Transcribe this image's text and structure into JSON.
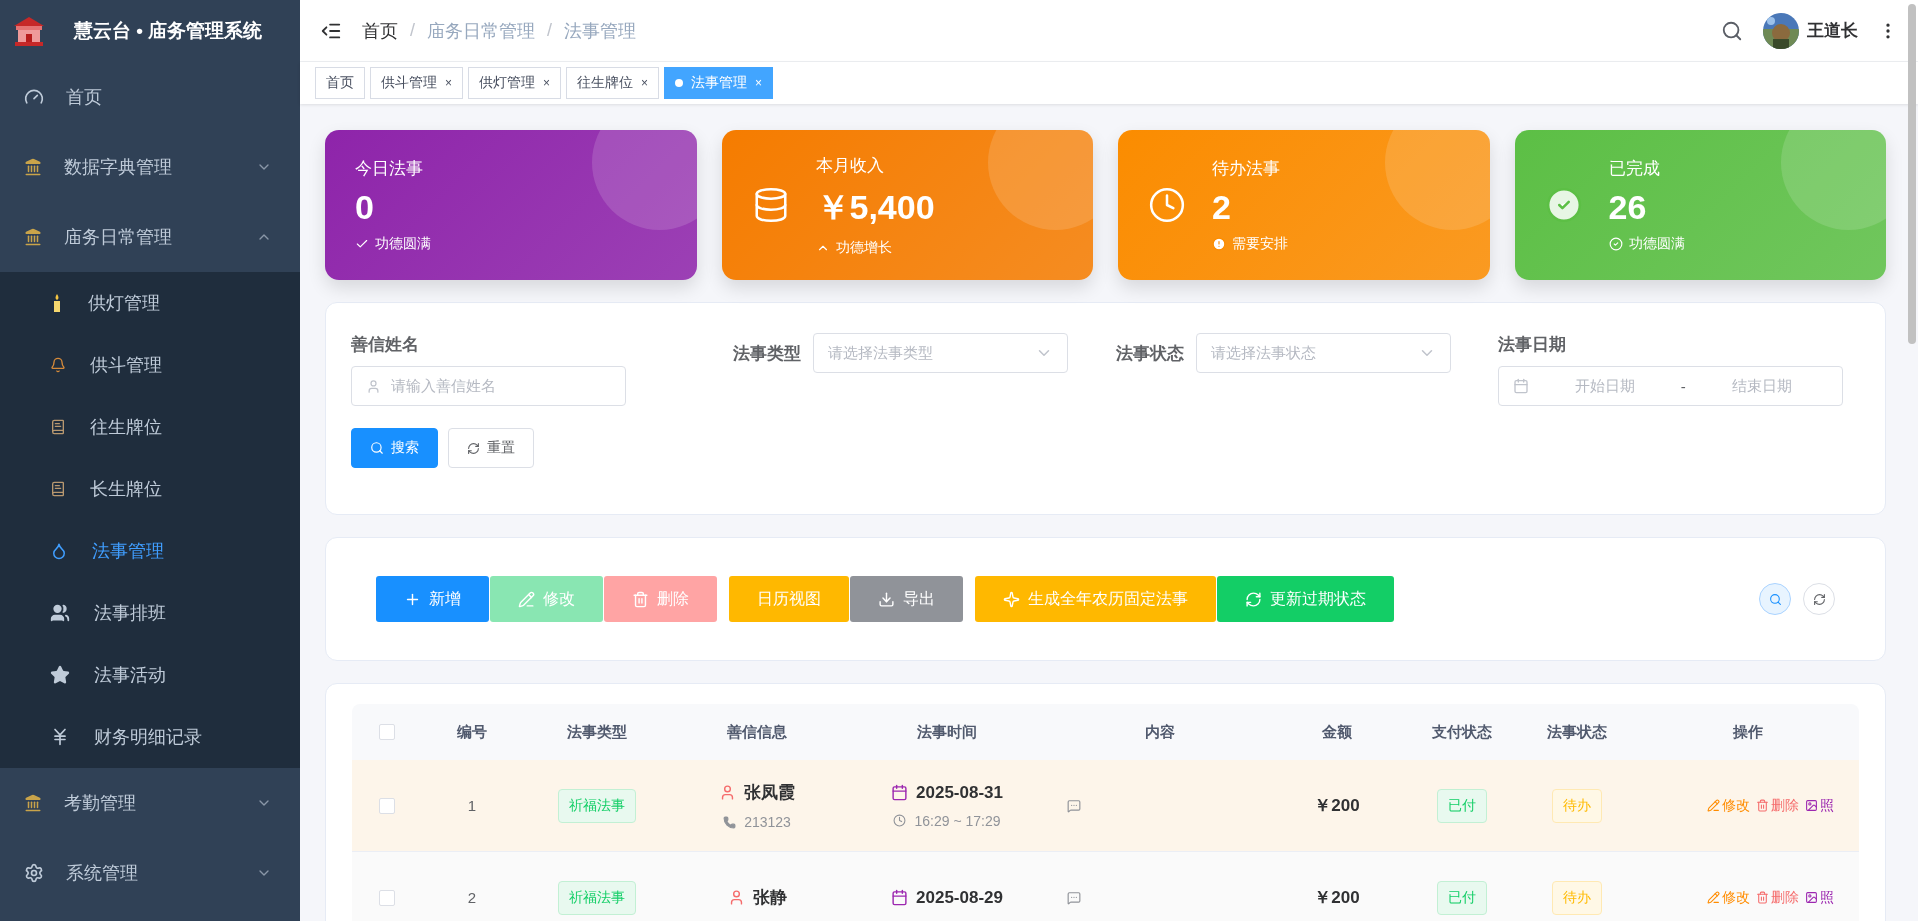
{
  "sidebar": {
    "title": "慧云台 • 庙务管理系统",
    "items": [
      {
        "label": "首页",
        "kind": "link",
        "selected": false
      },
      {
        "label": "数据字典管理",
        "kind": "group",
        "expanded": false
      },
      {
        "label": "庙务日常管理",
        "kind": "group",
        "expanded": true,
        "children": [
          {
            "label": "供灯管理",
            "selected": false
          },
          {
            "label": "供斗管理",
            "selected": false
          },
          {
            "label": "往生牌位",
            "selected": false
          },
          {
            "label": "长生牌位",
            "selected": false
          },
          {
            "label": "法事管理",
            "selected": true
          },
          {
            "label": "法事排班",
            "selected": false
          },
          {
            "label": "法事活动",
            "selected": false
          },
          {
            "label": "财务明细记录",
            "selected": false
          }
        ]
      },
      {
        "label": "考勤管理",
        "kind": "group",
        "expanded": false
      },
      {
        "label": "系统管理",
        "kind": "group",
        "expanded": false
      }
    ]
  },
  "header": {
    "breadcrumb": [
      "首页",
      "庙务日常管理",
      "法事管理"
    ],
    "separator": "/",
    "user": "王道长"
  },
  "tabs": [
    {
      "label": "首页",
      "closable": false,
      "selected": false
    },
    {
      "label": "供斗管理",
      "closable": true,
      "selected": false
    },
    {
      "label": "供灯管理",
      "closable": true,
      "selected": false
    },
    {
      "label": "往生牌位",
      "closable": true,
      "selected": false
    },
    {
      "label": "法事管理",
      "closable": true,
      "selected": true
    }
  ],
  "tab_close": "×",
  "stats": [
    {
      "title": "今日法事",
      "value": "0",
      "note": "功德圆满",
      "color": "#8e24aa"
    },
    {
      "title": "本月收入",
      "value": "￥5,400",
      "note": "功德增长",
      "color": "#f57c00"
    },
    {
      "title": "待办法事",
      "value": "2",
      "note": "需要安排",
      "color": "#fb8c00"
    },
    {
      "title": "已完成",
      "value": "26",
      "note": "功德圆满",
      "color": "#5cbf45"
    }
  ],
  "filters": [
    {
      "label": "善信姓名",
      "kind": "text",
      "placeholder": "请输入善信姓名"
    },
    {
      "label": "法事类型",
      "kind": "select",
      "placeholder": "请选择法事类型"
    },
    {
      "label": "法事状态",
      "kind": "select",
      "placeholder": "请选择法事状态"
    },
    {
      "label": "法事日期",
      "kind": "daterange",
      "start_placeholder": "开始日期",
      "separator": "-",
      "end_placeholder": "结束日期"
    }
  ],
  "filter_buttons": [
    {
      "label": "搜索",
      "kind": "primary"
    },
    {
      "label": "重置",
      "kind": "plain"
    }
  ],
  "toolbar": [
    [
      {
        "label": "新增",
        "color": "#1890ff"
      },
      {
        "label": "修改",
        "color": "#89e6b2"
      },
      {
        "label": "删除",
        "color": "#ffa4a4"
      }
    ],
    [
      {
        "label": "日历视图",
        "color": "#ffb800"
      },
      {
        "label": "导出",
        "color": "#909399"
      }
    ],
    [
      {
        "label": "生成全年农历固定法事",
        "color": "#ffb800"
      },
      {
        "label": "更新过期状态",
        "color": "#13ce66"
      }
    ]
  ],
  "table": {
    "all_checked": false,
    "columns": [
      "编号",
      "法事类型",
      "善信信息",
      "法事时间",
      "内容",
      "金额",
      "支付状态",
      "法事状态",
      "操作"
    ],
    "rows": [
      {
        "checked": false,
        "highlighted": true,
        "number": "1",
        "type": "祈福法事",
        "name": "张凤霞",
        "phone": "213123",
        "date": "2025-08-31",
        "time": "16:29 ~ 17:29",
        "amount": "￥200",
        "payment": "已付",
        "status": "待办",
        "actions": [
          {
            "label": "修改",
            "kind": "edit"
          },
          {
            "label": "删除",
            "kind": "delete"
          },
          {
            "label": "照"
          }
        ]
      },
      {
        "checked": false,
        "highlighted": false,
        "number": "2",
        "type": "祈福法事",
        "name": "张静",
        "date": "2025-08-29",
        "amount": "￥200",
        "payment": "已付",
        "status": "待办",
        "actions": [
          {
            "label": "修改",
            "kind": "edit"
          },
          {
            "label": "删除",
            "kind": "delete"
          },
          {
            "label": "照"
          }
        ]
      }
    ]
  }
}
